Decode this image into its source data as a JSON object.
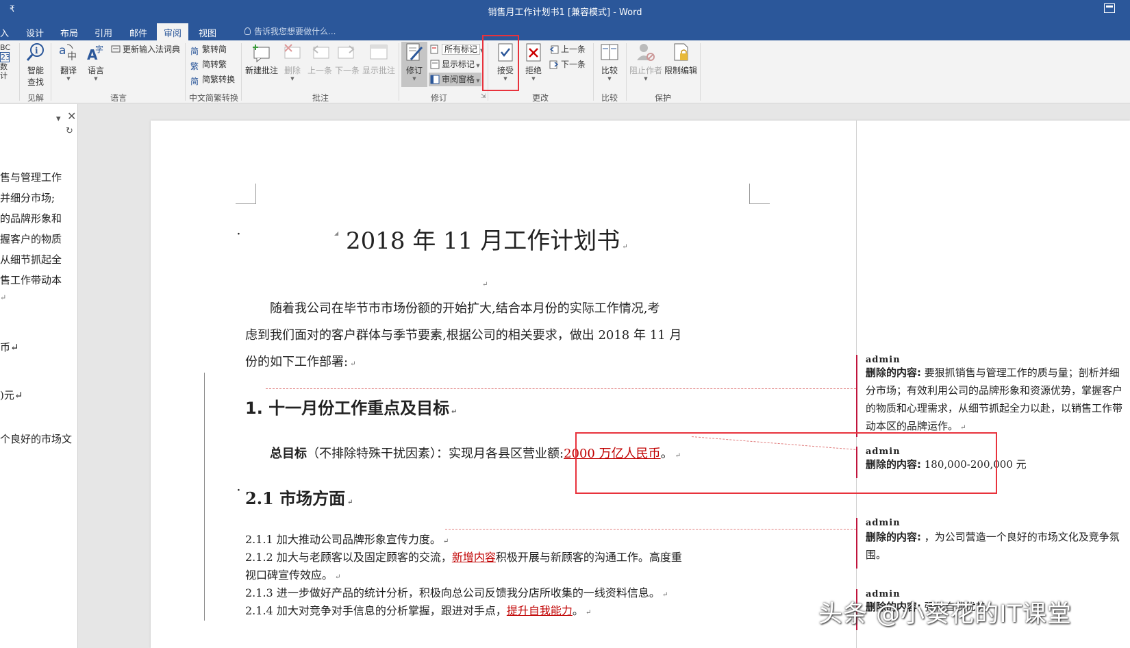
{
  "window": {
    "title": "销售月工作计划书1 [兼容模式] - Word",
    "qat_glyph": "₹"
  },
  "tabs": [
    {
      "label": "入"
    },
    {
      "label": "设计"
    },
    {
      "label": "布局"
    },
    {
      "label": "引用"
    },
    {
      "label": "邮件"
    },
    {
      "label": "审阅",
      "active": true
    },
    {
      "label": "视图"
    }
  ],
  "tell_me": {
    "placeholder": "告诉我您想要做什么..."
  },
  "ribbon": {
    "groups": {
      "proofing": "见解",
      "language": "语言",
      "chinese": "中文简繁转换",
      "comments": "批注",
      "tracking": "修订",
      "changes": "更改",
      "compare": "比较",
      "protect": "保护"
    },
    "proofing_partial": [
      "BC",
      "23",
      "数",
      "计"
    ],
    "smart_lookup": [
      "智能",
      "查找"
    ],
    "translate": "翻译",
    "language": "语言",
    "update_ime": "更新输入法词典",
    "trad_to_simp": "繁转简",
    "simp_to_trad": "简转繁",
    "convert": "简繁转换",
    "new_comment": "新建批注",
    "delete": "删除",
    "previous": "上一条",
    "next": "下一条",
    "show_comments": "显示批注",
    "track_changes": "修订",
    "markup_select": "所有标记",
    "show_markup": "显示标记",
    "review_pane": "审阅窗格",
    "accept": "接受",
    "reject": "拒绝",
    "change_prev": "上一条",
    "change_next": "下一条",
    "compare": "比较",
    "block_authors": "阻止作者",
    "restrict_editing": "限制编辑"
  },
  "nav_pane": {
    "lines": [
      "售与管理工作",
      "并细分市场;",
      "的品牌形象和",
      "握客户的物质",
      "从细节抓起全",
      "售工作带动本",
      "↵",
      "币↵",
      ")元↵",
      "个良好的市场文"
    ]
  },
  "document": {
    "title": "2018 年 11 月工作计划书",
    "intro": [
      "随着我公司在毕节市市场份额的开始扩大,结合本月份的实际工作情况,考",
      "虑到我们面对的客户群体与季节要素,根据公司的相关要求，做出 2018 年 11 月",
      "份的如下工作部署:"
    ],
    "h1": "1. 十一月份工作重点及目标",
    "goal_label": "总目标",
    "goal_text": "（不排除特殊干扰因素）：实现月各县区营业额:",
    "goal_inserted": "2000 万亿人民币",
    "goal_end": "。",
    "h2": "2.1   市场方面",
    "items": [
      {
        "num": "2.1.1",
        "text": "加大推动公司品牌形象宣传力度。"
      },
      {
        "num": "2.1.2",
        "text": "加大与老顾客以及固定顾客的交流，",
        "inserted": "新增内容",
        "rest": "积极开展与新顾客的沟通工作。高度重"
      },
      {
        "num": "",
        "text": "视口碑宣传效应。"
      },
      {
        "num": "2.1.3",
        "text": "进一步做好产品的统计分析，积极向总公司反馈我分店所收集的一线资料信息。"
      },
      {
        "num": "2.1.4",
        "text": "加大对竞争对手信息的分析掌握，跟进对手点，",
        "inserted": "提升自我能力",
        "rest": "。"
      }
    ]
  },
  "comments": [
    {
      "author": "admin",
      "label": "删除的内容:",
      "lines": [
        " 要狠抓销售与管理工作的质与量；剖析并细",
        "分市场；有效利用公司的品牌形象和资源优势，掌握客户",
        "的物质和心理需求，从细节抓起全力以赴，以销售工作带",
        "动本区的品牌运作。"
      ]
    },
    {
      "author": "admin",
      "label": "删除的内容:",
      "lines": [
        " 180,000-200,000 元"
      ]
    },
    {
      "author": "admin",
      "label": "删除的内容:",
      "lines": [
        " ，为公司营造一个良好的市场文化及竞争氛",
        "围。"
      ]
    },
    {
      "author": "admin",
      "label": "删除的内容:",
      "lines": [
        " 强化自我优势"
      ]
    }
  ],
  "watermark": "头条 @小葵花的IT课堂",
  "colors": {
    "word_blue": "#2b579a",
    "highlight_red": "#e8323c",
    "revision_red": "#c00000"
  }
}
